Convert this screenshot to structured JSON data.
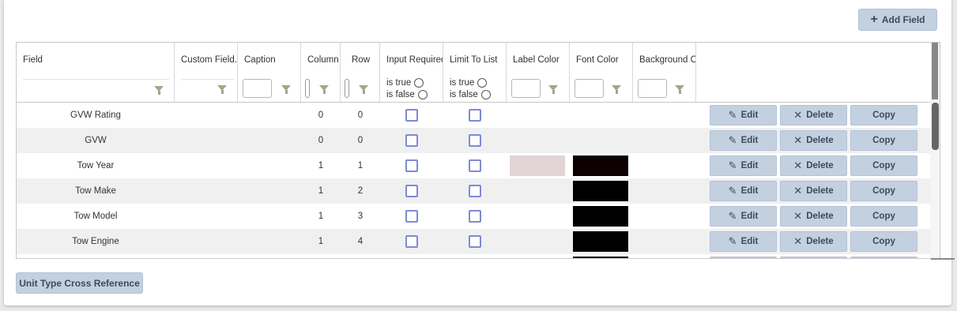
{
  "toolbar": {
    "add_field_label": "Add Field",
    "add_icon": "plus-icon"
  },
  "footer": {
    "xref_label": "Unit Type Cross Reference"
  },
  "columns": {
    "field": "Field",
    "custom_field": "Custom Field...",
    "caption": "Caption",
    "column": "Column",
    "row": "Row",
    "input_required": "Input Required",
    "limit_to_list": "Limit To List",
    "label_color": "Label Color",
    "font_color": "Font Color",
    "background_color": "Background C"
  },
  "filter": {
    "is_true": "is true",
    "is_false": "is false",
    "icon": "filter-funnel-icon"
  },
  "actions": {
    "edit": "Edit",
    "delete": "Delete",
    "copy": "Copy"
  },
  "rows": [
    {
      "field": "GVW Rating",
      "column": "0",
      "row": "0",
      "label_color": "",
      "font_color": ""
    },
    {
      "field": "GVW",
      "column": "0",
      "row": "0",
      "label_color": "",
      "font_color": ""
    },
    {
      "field": "Tow Year",
      "column": "1",
      "row": "1",
      "label_color": "#e2d4d4",
      "font_color": "#0d0000"
    },
    {
      "field": "Tow Make",
      "column": "1",
      "row": "2",
      "label_color": "",
      "font_color": "#000000"
    },
    {
      "field": "Tow Model",
      "column": "1",
      "row": "3",
      "label_color": "",
      "font_color": "#000000"
    },
    {
      "field": "Tow Engine",
      "column": "1",
      "row": "4",
      "label_color": "",
      "font_color": "#000000"
    }
  ]
}
